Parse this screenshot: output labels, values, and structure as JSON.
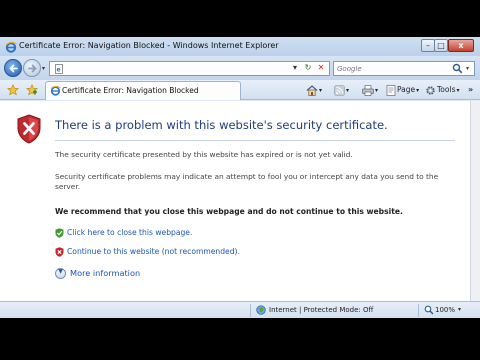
{
  "window": {
    "title": "Certificate Error: Navigation Blocked - Windows Internet Explorer",
    "minimize": "–",
    "maximize": "□",
    "close": "x"
  },
  "address_bar": {
    "value": "",
    "refresh": "↻",
    "stop": "✕",
    "dropdown": "▾"
  },
  "search": {
    "placeholder": "Google",
    "dropdown": "▾"
  },
  "tab": {
    "label": "Certificate Error: Navigation Blocked"
  },
  "commands": {
    "home_dd": "▾",
    "feeds_dd": "▾",
    "print_dd": "▾",
    "page_label": "Page",
    "page_dd": "▾",
    "tools_label": "Tools",
    "tools_dd": "▾",
    "more": "»"
  },
  "content": {
    "heading": "There is a problem with this website's security certificate.",
    "paragraph1": "The security certificate presented by this website has expired or is not yet valid.",
    "paragraph2": "Security certificate problems may indicate an attempt to fool you or intercept any data you send to the server.",
    "recommendation": "We recommend that you close this webpage and do not continue to this website.",
    "close_link": "Click here to close this webpage.",
    "continue_link": "Continue to this website (not recommended).",
    "more_info": "More information"
  },
  "status_bar": {
    "zone": "Internet | Protected Mode: Off",
    "zoom": "100%",
    "zoom_dd": "▾"
  },
  "colors": {
    "heading": "#1f3d7a",
    "link": "#1d56b3",
    "shield_red": "#c0282d",
    "shield_green": "#3f9a2f"
  }
}
